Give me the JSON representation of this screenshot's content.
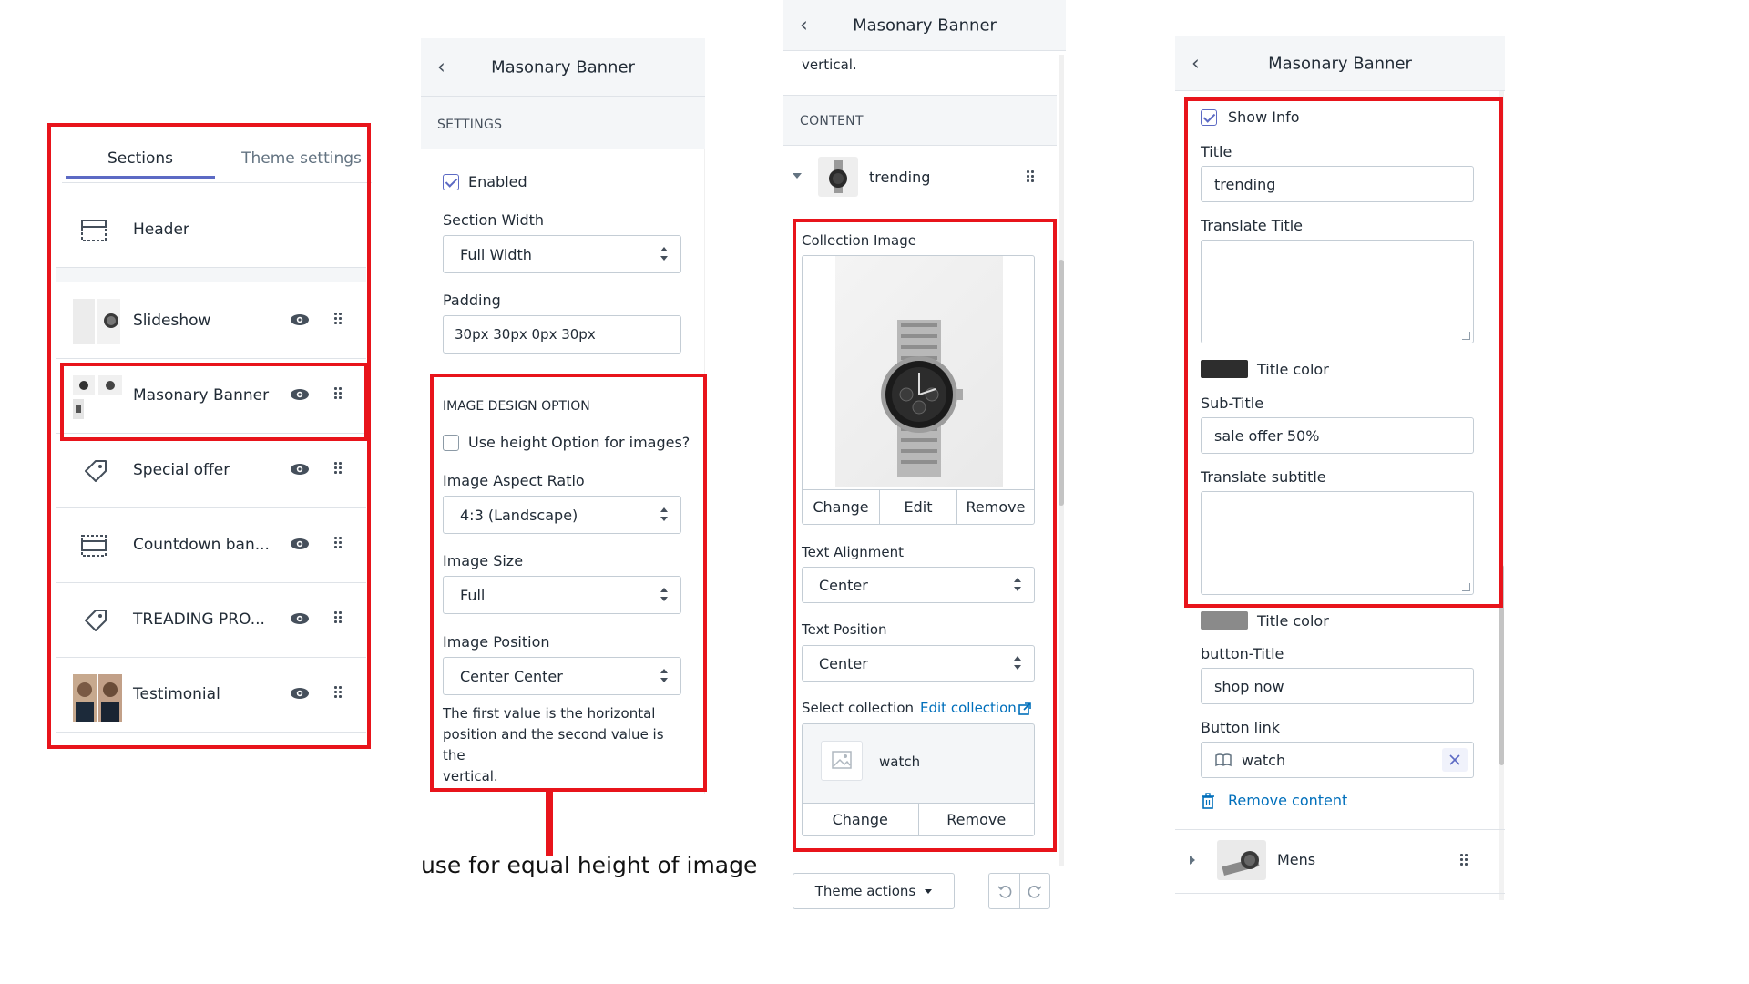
{
  "colors": {
    "highlight": "#e8141b",
    "accent": "#5c6ac4",
    "link": "#006fbb",
    "title_color_dark": "#2d2d2d",
    "title_color_gray": "#8a8a8a"
  },
  "panel1": {
    "tabs": [
      "Sections",
      "Theme settings"
    ],
    "rows": [
      {
        "label": "Header",
        "icon": "header-layout-icon"
      },
      {
        "label": "Slideshow",
        "icon": "slideshow-thumbnail"
      },
      {
        "label": "Masonary Banner",
        "icon": "masonry-thumbnail"
      },
      {
        "label": "Special offer",
        "icon": "tag-icon"
      },
      {
        "label": "Countdown ban...",
        "icon": "countdown-layout-icon"
      },
      {
        "label": "TREADING PRO...",
        "icon": "tag-icon"
      },
      {
        "label": "Testimonial",
        "icon": "testimonial-thumbnail"
      }
    ]
  },
  "panel2": {
    "title": "Masonary Banner",
    "settings_header": "SETTINGS",
    "enabled_label": "Enabled",
    "section_width_label": "Section Width",
    "section_width_value": "Full Width",
    "padding_label": "Padding",
    "padding_value": "30px 30px 0px 30px",
    "design_header": "IMAGE DESIGN OPTION",
    "height_option_label": "Use height Option for images?",
    "aspect_label": "Image Aspect Ratio",
    "aspect_value": "4:3 (Landscape)",
    "size_label": "Image Size",
    "size_value": "Full",
    "position_label": "Image Position",
    "position_value": "Center Center",
    "help_text_1": "The first value is the horizontal",
    "help_text_2": "position and the second value is the",
    "help_text_3": "vertical.",
    "annotation": "use for equal height of image"
  },
  "panel3": {
    "title": "Masonary Banner",
    "top_text": "vertical.",
    "content_header": "CONTENT",
    "block_name": "trending",
    "collection_image_label": "Collection Image",
    "image_buttons": [
      "Change",
      "Edit",
      "Remove"
    ],
    "text_alignment_label": "Text Alignment",
    "text_alignment_value": "Center",
    "text_position_label": "Text Position",
    "text_position_value": "Center",
    "select_collection_label": "Select collection",
    "edit_collection_link": "Edit collection",
    "collection_name": "watch",
    "collection_buttons": [
      "Change",
      "Remove"
    ],
    "theme_actions": "Theme actions"
  },
  "panel4": {
    "title": "Masonary Banner",
    "show_info_label": "Show Info",
    "title_label": "Title",
    "title_value": "trending",
    "translate_title_label": "Translate Title",
    "title_color_label_1": "Title color",
    "subtitle_label": "Sub-Title",
    "subtitle_value": "sale offer 50%",
    "translate_subtitle_label": "Translate subtitle",
    "title_color_label_2": "Title color",
    "button_title_label": "button-Title",
    "button_title_value": "shop now",
    "button_link_label": "Button link",
    "button_link_value": "watch",
    "remove_content": "Remove content",
    "next_block": "Mens"
  }
}
